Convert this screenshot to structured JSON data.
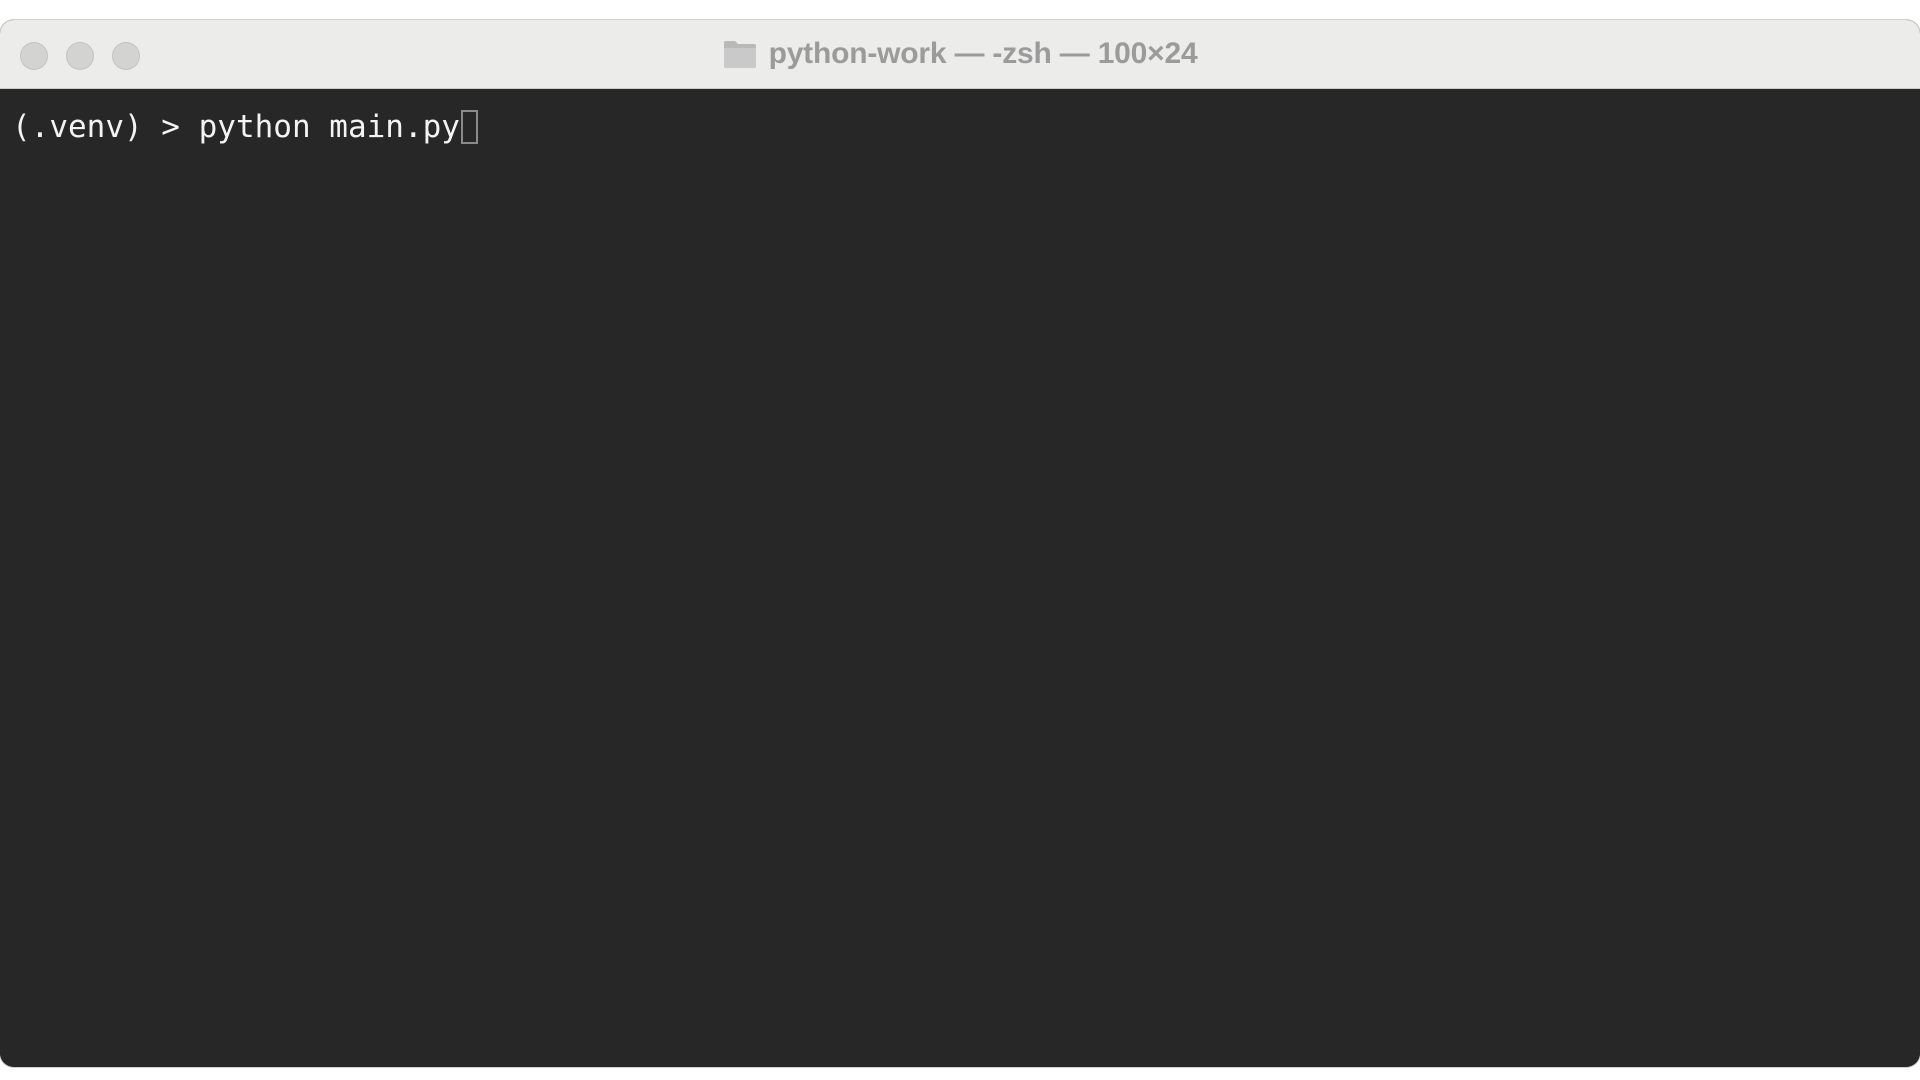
{
  "window": {
    "title": "python-work — -zsh — 100×24"
  },
  "terminal": {
    "prompt": "(.venv) > ",
    "command": "python main.py"
  },
  "icons": {
    "folder": "folder-icon",
    "close": "close-button",
    "minimize": "minimize-button",
    "zoom": "zoom-button"
  },
  "colors": {
    "titlebar": "#ececeb",
    "terminal_bg": "#272727",
    "text": "#f3f3f3",
    "title_text": "#9b9b9b",
    "traffic_light_inactive": "#d3d3d2"
  }
}
